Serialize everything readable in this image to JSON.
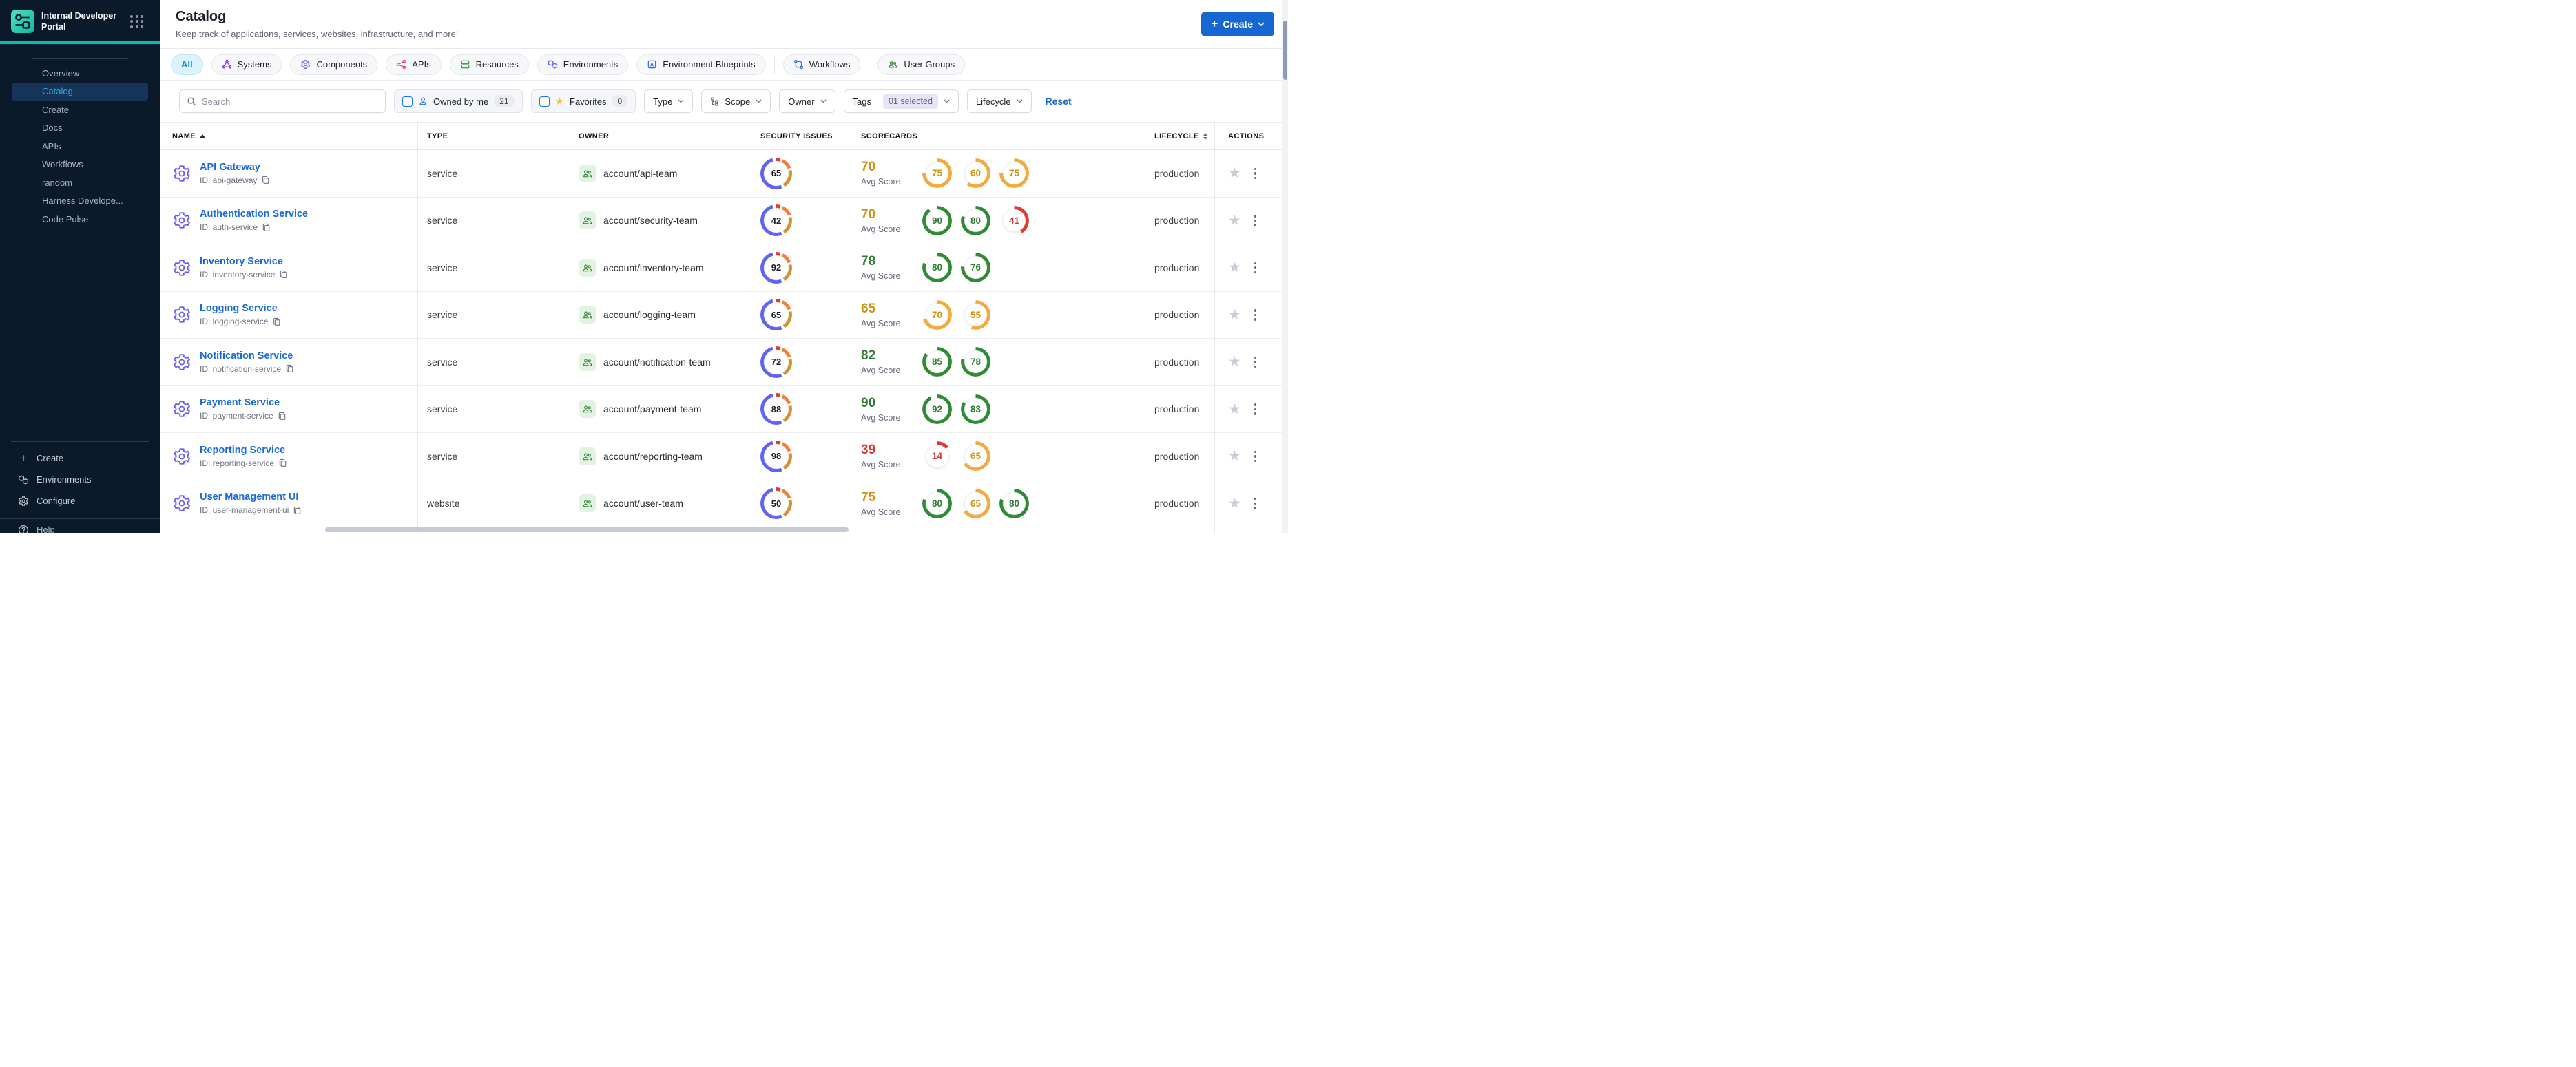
{
  "sidebar": {
    "brand_title": "Internal Developer Portal",
    "nav": [
      {
        "label": "Overview",
        "active": false
      },
      {
        "label": "Catalog",
        "active": true
      },
      {
        "label": "Create",
        "active": false
      },
      {
        "label": "Docs",
        "active": false
      },
      {
        "label": "APIs",
        "active": false
      },
      {
        "label": "Workflows",
        "active": false
      },
      {
        "label": "random",
        "active": false
      },
      {
        "label": "Harness Develope...",
        "active": false
      },
      {
        "label": "Code Pulse",
        "active": false
      }
    ],
    "bottom_items": [
      {
        "label": "Create",
        "icon": "plus-icon"
      },
      {
        "label": "Environments",
        "icon": "environments-icon"
      },
      {
        "label": "Configure",
        "icon": "gear-icon"
      }
    ],
    "footer_label": "Help"
  },
  "header": {
    "title": "Catalog",
    "subtitle": "Keep track of applications, services, websites, infrastructure, and more!",
    "create_button": "Create"
  },
  "tabs": [
    {
      "label": "All",
      "active": true
    },
    {
      "label": "Systems",
      "icon": "systems-icon",
      "color": "#7a2ff2"
    },
    {
      "label": "Components",
      "icon": "components-icon",
      "color": "#5d4df0"
    },
    {
      "label": "APIs",
      "icon": "apis-icon",
      "color": "#e0447c"
    },
    {
      "label": "Resources",
      "icon": "resources-icon",
      "color": "#3da53f"
    },
    {
      "label": "Environments",
      "icon": "environments-icon",
      "color": "#5a5cf0"
    },
    {
      "label": "Environment Blueprints",
      "icon": "blueprints-icon",
      "color": "#2b6fe0"
    },
    {
      "divider": true
    },
    {
      "label": "Workflows",
      "icon": "workflows-icon",
      "color": "#2b6fe0"
    },
    {
      "divider": true
    },
    {
      "label": "User Groups",
      "icon": "usergroups-icon",
      "color": "#2e7d32"
    }
  ],
  "filters": {
    "search_placeholder": "Search",
    "owned_by_me_label": "Owned by me",
    "owned_by_me_count": "21",
    "favorites_label": "Favorites",
    "favorites_count": "0",
    "type_label": "Type",
    "scope_label": "Scope",
    "owner_label": "Owner",
    "tags_label": "Tags",
    "tags_selected": "01 selected",
    "lifecycle_label": "Lifecycle",
    "reset_label": "Reset"
  },
  "table": {
    "columns": [
      "NAME",
      "TYPE",
      "OWNER",
      "SECURITY ISSUES",
      "SCORECARDS",
      "LIFECYCLE",
      "ACTIONS"
    ],
    "avg_label": "Avg Score",
    "rows": [
      {
        "name": "API Gateway",
        "id": "ID: api-gateway",
        "type": "service",
        "owner": "account/api-team",
        "security": 65,
        "avg": 70,
        "avg_band": "orange",
        "scorecards": [
          {
            "v": 75,
            "band": "orange"
          },
          {
            "v": 60,
            "band": "orange"
          },
          {
            "v": 75,
            "band": "orange"
          }
        ],
        "lifecycle": "production"
      },
      {
        "name": "Authentication Service",
        "id": "ID: auth-service",
        "type": "service",
        "owner": "account/security-team",
        "security": 42,
        "avg": 70,
        "avg_band": "orange",
        "scorecards": [
          {
            "v": 90,
            "band": "green"
          },
          {
            "v": 80,
            "band": "green"
          },
          {
            "v": 41,
            "band": "red"
          }
        ],
        "lifecycle": "production"
      },
      {
        "name": "Inventory Service",
        "id": "ID: inventory-service",
        "type": "service",
        "owner": "account/inventory-team",
        "security": 92,
        "avg": 78,
        "avg_band": "green",
        "scorecards": [
          {
            "v": 80,
            "band": "green"
          },
          {
            "v": 76,
            "band": "green"
          }
        ],
        "lifecycle": "production"
      },
      {
        "name": "Logging Service",
        "id": "ID: logging-service",
        "type": "service",
        "owner": "account/logging-team",
        "security": 65,
        "avg": 65,
        "avg_band": "orange",
        "scorecards": [
          {
            "v": 70,
            "band": "orange"
          },
          {
            "v": 55,
            "band": "orange"
          }
        ],
        "lifecycle": "production"
      },
      {
        "name": "Notification Service",
        "id": "ID: notification-service",
        "type": "service",
        "owner": "account/notification-team",
        "security": 72,
        "avg": 82,
        "avg_band": "green",
        "scorecards": [
          {
            "v": 85,
            "band": "green"
          },
          {
            "v": 78,
            "band": "green"
          }
        ],
        "lifecycle": "production"
      },
      {
        "name": "Payment Service",
        "id": "ID: payment-service",
        "type": "service",
        "owner": "account/payment-team",
        "security": 88,
        "avg": 90,
        "avg_band": "green",
        "scorecards": [
          {
            "v": 92,
            "band": "green"
          },
          {
            "v": 83,
            "band": "green"
          }
        ],
        "lifecycle": "production"
      },
      {
        "name": "Reporting Service",
        "id": "ID: reporting-service",
        "type": "service",
        "owner": "account/reporting-team",
        "security": 98,
        "avg": 39,
        "avg_band": "red",
        "scorecards": [
          {
            "v": 14,
            "band": "red"
          },
          {
            "v": 65,
            "band": "orange"
          }
        ],
        "lifecycle": "production"
      },
      {
        "name": "User Management UI",
        "id": "ID: user-management-ui",
        "type": "website",
        "owner": "account/user-team",
        "security": 50,
        "avg": 75,
        "avg_band": "orange",
        "scorecards": [
          {
            "v": 80,
            "band": "green"
          },
          {
            "v": 65,
            "band": "orange"
          },
          {
            "v": 80,
            "band": "green"
          }
        ],
        "lifecycle": "production"
      }
    ]
  },
  "colors": {
    "sidebar_bg": "#0b1a2b",
    "teal_accent": "#00c2ab",
    "primary_blue": "#1767d3",
    "link_blue": "#1a6bd8",
    "active_nav_text": "#31a9e6",
    "band_orange": "#d19113",
    "band_green": "#2e7d32",
    "band_red": "#da3b30"
  }
}
